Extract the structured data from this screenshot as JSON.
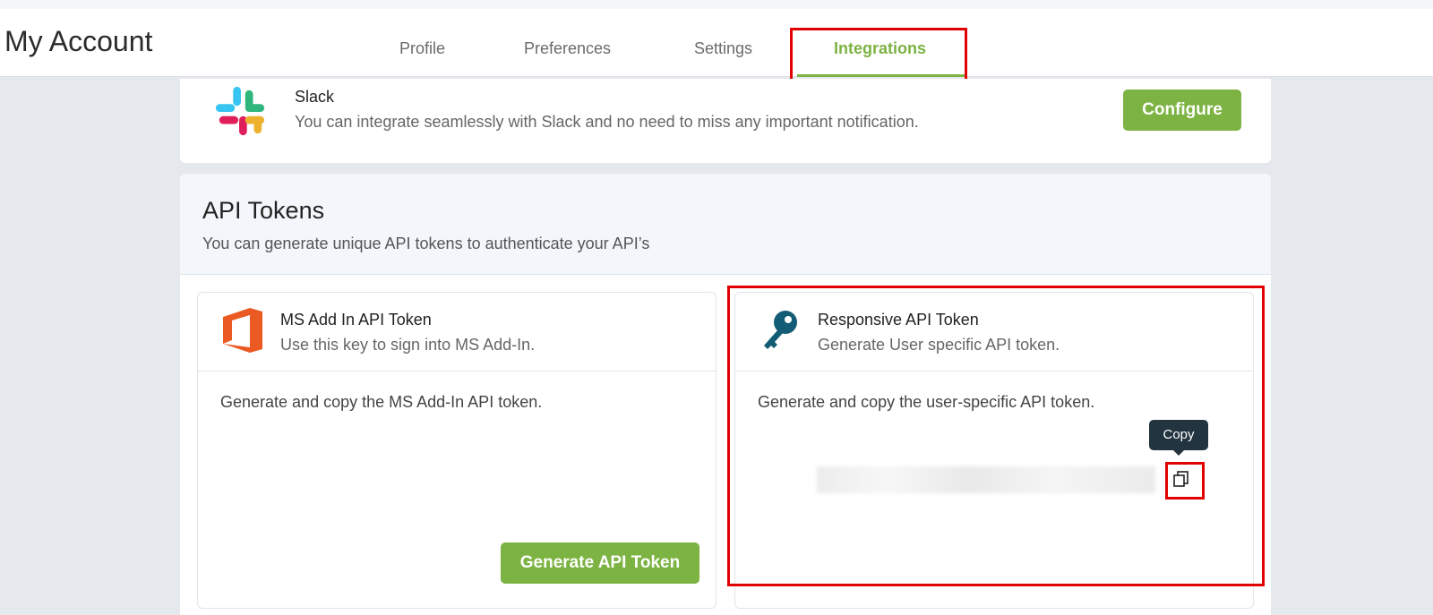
{
  "app": {
    "title": "My Account"
  },
  "tabs": [
    {
      "label": "Profile",
      "active": false
    },
    {
      "label": "Preferences",
      "active": false
    },
    {
      "label": "Settings",
      "active": false
    },
    {
      "label": "Integrations",
      "active": true
    }
  ],
  "slack": {
    "title": "Slack",
    "description": "You can integrate seamlessly with Slack and no need to miss any important notification.",
    "button_label": "Configure"
  },
  "api_tokens": {
    "title": "API Tokens",
    "description": "You can generate unique API tokens to authenticate your API’s",
    "cards": [
      {
        "title": "MS Add In API Token",
        "subtitle": "Use this key to sign into MS Add-In.",
        "body": "Generate and copy the MS Add-In API token.",
        "button_label": "Generate API Token",
        "icon": "office-icon"
      },
      {
        "title": "Responsive API Token",
        "subtitle": "Generate User specific API token.",
        "body": "Generate and copy the user-specific API token.",
        "tooltip": "Copy",
        "icon": "key-icon"
      }
    ]
  },
  "colors": {
    "accent": "#7cb342",
    "highlight": "#e10000",
    "tooltip_bg": "#22343f",
    "office": "#eb5a23",
    "key": "#135c75"
  }
}
